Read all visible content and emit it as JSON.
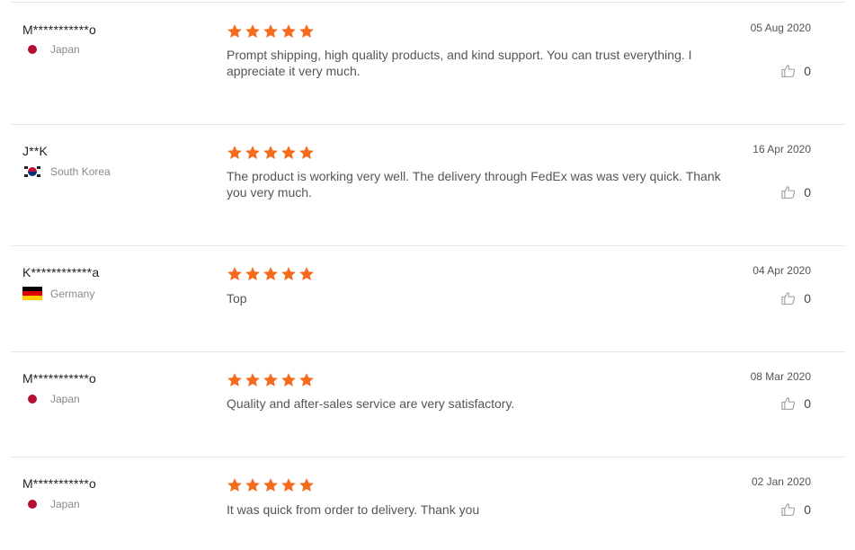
{
  "colors": {
    "star": "#f56a1b",
    "thumb_stroke": "#9a9a9a"
  },
  "reviews": [
    {
      "user": "M***********o",
      "country": "Japan",
      "flag": "jp",
      "rating": 5,
      "text": "Prompt shipping, high quality products, and kind support.  You can trust everything.  I appreciate it very much.",
      "date": "05 Aug 2020",
      "helpful_count": "0"
    },
    {
      "user": "J**K",
      "country": "South Korea",
      "flag": "kr",
      "rating": 5,
      "text": "The product is working very well. The delivery through FedEx was was very quick. Thank you very much.",
      "date": "16 Apr 2020",
      "helpful_count": "0"
    },
    {
      "user": "K************a",
      "country": "Germany",
      "flag": "de",
      "rating": 5,
      "text": "Top",
      "date": "04 Apr 2020",
      "helpful_count": "0"
    },
    {
      "user": "M***********o",
      "country": "Japan",
      "flag": "jp",
      "rating": 5,
      "text": "Quality and after-sales service are very satisfactory.",
      "date": "08 Mar 2020",
      "helpful_count": "0"
    },
    {
      "user": "M***********o",
      "country": "Japan",
      "flag": "jp",
      "rating": 5,
      "text": "It was quick from order to delivery.  Thank you",
      "date": "02 Jan 2020",
      "helpful_count": "0"
    }
  ]
}
